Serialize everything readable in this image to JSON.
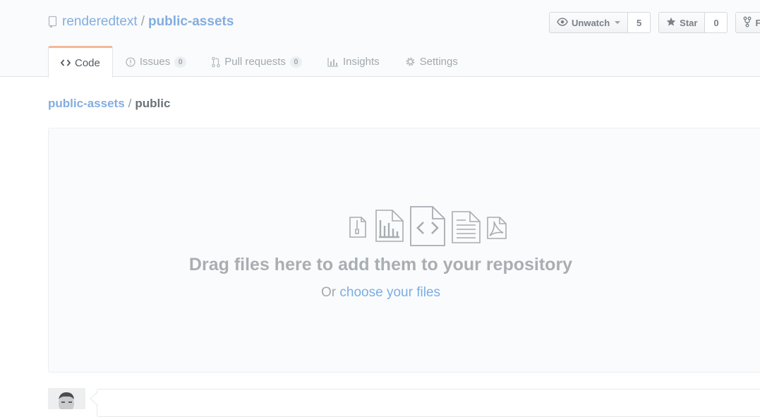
{
  "repo": {
    "owner": "renderedtext",
    "separator": "/",
    "name": "public-assets"
  },
  "actions": {
    "watch_label": "Unwatch",
    "watch_count": "5",
    "star_label": "Star",
    "star_count": "0",
    "fork_label": "F"
  },
  "tabs": [
    {
      "label": "Code",
      "icon": "code-icon"
    },
    {
      "label": "Issues",
      "count": "0",
      "icon": "issue-icon"
    },
    {
      "label": "Pull requests",
      "count": "0",
      "icon": "pull-request-icon"
    },
    {
      "label": "Insights",
      "icon": "graph-icon"
    },
    {
      "label": "Settings",
      "icon": "gear-icon"
    }
  ],
  "breadcrumb": {
    "root": "public-assets",
    "separator": "/",
    "current": "public"
  },
  "dropzone": {
    "icons": [
      "file-zip-icon",
      "file-chart-icon",
      "file-code-icon",
      "file-text-icon",
      "file-pdf-icon"
    ],
    "title": "Drag files here to add them to your repository",
    "or_text": "Or",
    "link_text": "choose your files"
  },
  "colors": {
    "link": "#83ade0",
    "selected_tab_accent": "#f3b897",
    "muted": "#a2a8ae"
  }
}
